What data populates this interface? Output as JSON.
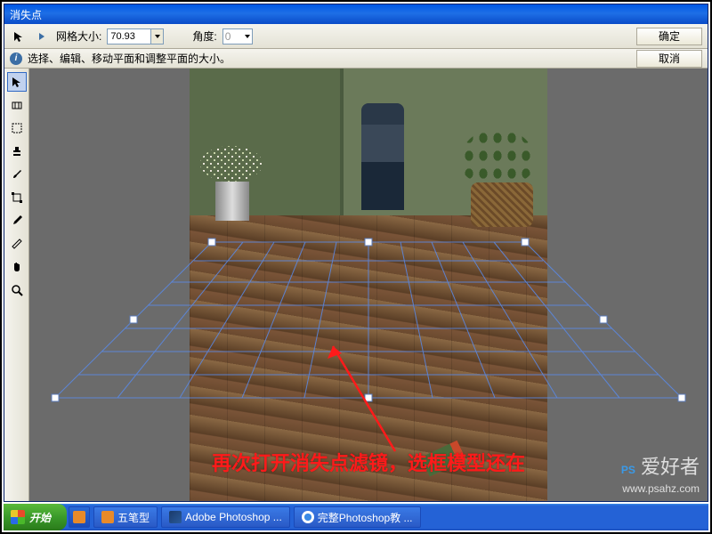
{
  "window": {
    "title": "消失点"
  },
  "toolbar": {
    "grid_label": "网格大小:",
    "grid_value": "70.93",
    "angle_label": "角度:",
    "angle_value": "0",
    "ok_label": "确定"
  },
  "infobar": {
    "hint": "选择、编辑、移动平面和调整平面的大小。",
    "cancel_label": "取消"
  },
  "tools": [
    {
      "name": "edit-plane",
      "icon": "arrow"
    },
    {
      "name": "create-plane",
      "icon": "grid"
    },
    {
      "name": "marquee",
      "icon": "marquee"
    },
    {
      "name": "stamp",
      "icon": "stamp"
    },
    {
      "name": "brush",
      "icon": "brush"
    },
    {
      "name": "transform",
      "icon": "transform"
    },
    {
      "name": "eyedropper",
      "icon": "eyedropper"
    },
    {
      "name": "measure",
      "icon": "measure"
    },
    {
      "name": "hand",
      "icon": "hand"
    },
    {
      "name": "zoom",
      "icon": "zoom"
    }
  ],
  "annotation": {
    "text": "再次打开消失点滤镜，选框模型还在"
  },
  "taskbar": {
    "start": "开始",
    "items": [
      {
        "label": "五笔型",
        "icon": "ime"
      },
      {
        "label": "Adobe Photoshop ...",
        "icon": "ps"
      },
      {
        "label": "完整Photoshop教 ...",
        "icon": "ie"
      }
    ]
  },
  "watermark": {
    "line1": "PS 爱好者",
    "line2": "www.psahz.com"
  }
}
